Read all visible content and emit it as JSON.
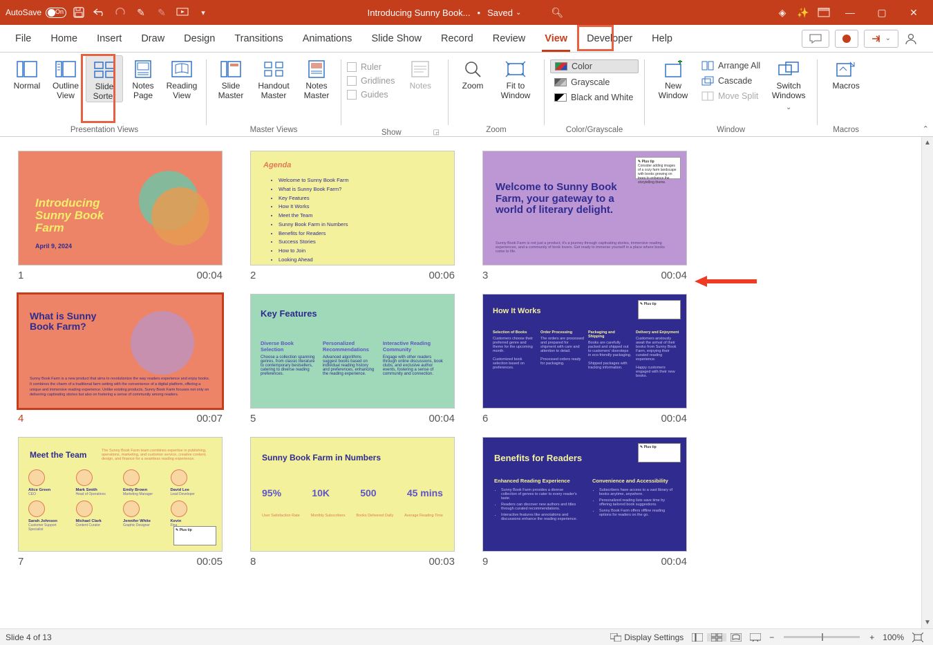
{
  "titlebar": {
    "autosave": "AutoSave",
    "toggle": "On",
    "doc_title": "Introducing Sunny Book...",
    "save_state": "Saved"
  },
  "tabs": [
    "File",
    "Home",
    "Insert",
    "Draw",
    "Design",
    "Transitions",
    "Animations",
    "Slide Show",
    "Record",
    "Review",
    "View",
    "Developer",
    "Help"
  ],
  "active_tab": "View",
  "ribbon": {
    "presentation_views": {
      "label": "Presentation Views",
      "normal": "Normal",
      "outline": "Outline\nView",
      "sorter": "Slide\nSorter",
      "notes": "Notes\nPage",
      "reading": "Reading\nView"
    },
    "master_views": {
      "label": "Master Views",
      "slide": "Slide\nMaster",
      "handout": "Handout\nMaster",
      "notes": "Notes\nMaster"
    },
    "show": {
      "label": "Show",
      "ruler": "Ruler",
      "gridlines": "Gridlines",
      "guides": "Guides"
    },
    "notes_btn": "Notes",
    "zoom_group": {
      "label": "Zoom",
      "zoom": "Zoom",
      "fit": "Fit to\nWindow"
    },
    "color_group": {
      "label": "Color/Grayscale",
      "color": "Color",
      "gray": "Grayscale",
      "bw": "Black and White"
    },
    "window_group": {
      "label": "Window",
      "new": "New\nWindow",
      "arrange": "Arrange All",
      "cascade": "Cascade",
      "move": "Move Split",
      "switch": "Switch\nWindows"
    },
    "macros": {
      "label": "Macros",
      "btn": "Macros"
    }
  },
  "slides": [
    {
      "num": "1",
      "time": "00:04",
      "title": "Introducing\nSunny Book\nFarm",
      "date": "April 9, 2024"
    },
    {
      "num": "2",
      "time": "00:06",
      "title": "Agenda",
      "items": [
        "Welcome to Sunny Book Farm",
        "What is Sunny Book Farm?",
        "Key Features",
        "How It Works",
        "Meet the Team",
        "Sunny Book Farm in Numbers",
        "Benefits for Readers",
        "Success Stories",
        "How to Join",
        "Looking Ahead"
      ]
    },
    {
      "num": "3",
      "time": "00:04",
      "title": "Welcome to Sunny Book Farm, your gateway to a world of literary delight.",
      "sub": "Sunny Book Farm is not just a product; it's a journey through captivating stories, immersive reading experiences, and a community of book lovers. Get ready to immerse yourself in a place where books come to life.",
      "note": "Consider adding images of a cozy farm landscape with books growing on trees to enhance the storytelling theme."
    },
    {
      "num": "4",
      "time": "00:07",
      "title": "What is Sunny\nBook Farm?",
      "body": "Sunny Book Farm is a new product that aims to revolutionize the way readers experience and enjoy books. It combines the charm of a traditional farm setting with the convenience of a digital platform, offering a unique and immersive reading experience. Unlike existing products, Sunny Book Farm focuses not only on delivering captivating stories but also on fostering a sense of community among readers.",
      "selected": true
    },
    {
      "num": "5",
      "time": "00:04",
      "title": "Key Features",
      "cols": [
        {
          "h": "Diverse Book Selection",
          "b": "Choose a collection spanning genres, from classic literature to contemporary bestsellers, catering to diverse reading preferences."
        },
        {
          "h": "Personalized Recommendations",
          "b": "Advanced algorithms suggest books based on individual reading history and preferences, enhancing the reading experience."
        },
        {
          "h": "Interactive Reading Community",
          "b": "Engage with other readers through online discussions, book clubs, and exclusive author events, fostering a sense of community and connection."
        }
      ]
    },
    {
      "num": "6",
      "time": "00:04",
      "title": "How It Works",
      "cols": [
        {
          "h": "Selection of Books",
          "b": "Customers choose their preferred genre and theme for the upcoming month.",
          "b2": "Customized book selection based on preferences."
        },
        {
          "h": "Order Processing",
          "b": "The orders are processed and prepared for shipment with care and attention to detail.",
          "b2": "Processed orders ready for packaging."
        },
        {
          "h": "Packaging and Shipping",
          "b": "Books are carefully packed and shipped out to customers' doorsteps in eco-friendly packaging.",
          "b2": "Shipped packages with tracking information."
        },
        {
          "h": "Delivery and Enjoyment",
          "b": "Customers anxiously await the arrival of their books from Sunny Book Farm, enjoying their curated reading experience.",
          "b2": "Happy customers engaged with their new books."
        }
      ]
    },
    {
      "num": "7",
      "time": "00:05",
      "title": "Meet the Team",
      "sub": "The Sunny Book Farm team combines expertise in publishing, operations, marketing, and customer service, creative content, design, and finance for a seamless reading experience.",
      "members": [
        {
          "n": "Alice Green",
          "r": "CEO"
        },
        {
          "n": "Mark Smith",
          "r": "Head of Operations"
        },
        {
          "n": "Emily Brown",
          "r": "Marketing Manager"
        },
        {
          "n": "David Lee",
          "r": "Lead Developer"
        },
        {
          "n": "Sarah Johnson",
          "r": "Customer Support Specialist"
        },
        {
          "n": "Michael Clark",
          "r": "Content Curator"
        },
        {
          "n": "Jennifer White",
          "r": "Graphic Designer"
        },
        {
          "n": "Kevin",
          "r": "Fina"
        }
      ]
    },
    {
      "num": "8",
      "time": "00:03",
      "title": "Sunny Book Farm in Numbers",
      "nums": [
        "95%",
        "10K",
        "500",
        "45 mins"
      ],
      "caps": [
        "User Satisfaction Rate",
        "Monthly Subscribers",
        "Books Delivered Daily",
        "Average Reading Time"
      ]
    },
    {
      "num": "9",
      "time": "00:04",
      "title": "Benefits for Readers",
      "cols": [
        {
          "h": "Enhanced Reading Experience",
          "items": [
            "Sunny Book Farm provides a diverse collection of genres to cater to every reader's taste.",
            "Readers can discover new authors and titles through curated recommendations.",
            "Interactive features like annotations and discussions enhance the reading experience."
          ]
        },
        {
          "h": "Convenience and Accessibility",
          "items": [
            "Subscribers have access to a vast library of books anytime, anywhere.",
            "Personalized reading lists save time by offering tailored book suggestions.",
            "Sunny Book Farm offers offline reading options for readers on the go."
          ]
        }
      ]
    }
  ],
  "status": {
    "slide_of": "Slide 4 of 13",
    "display": "Display Settings",
    "zoom": "100%"
  }
}
